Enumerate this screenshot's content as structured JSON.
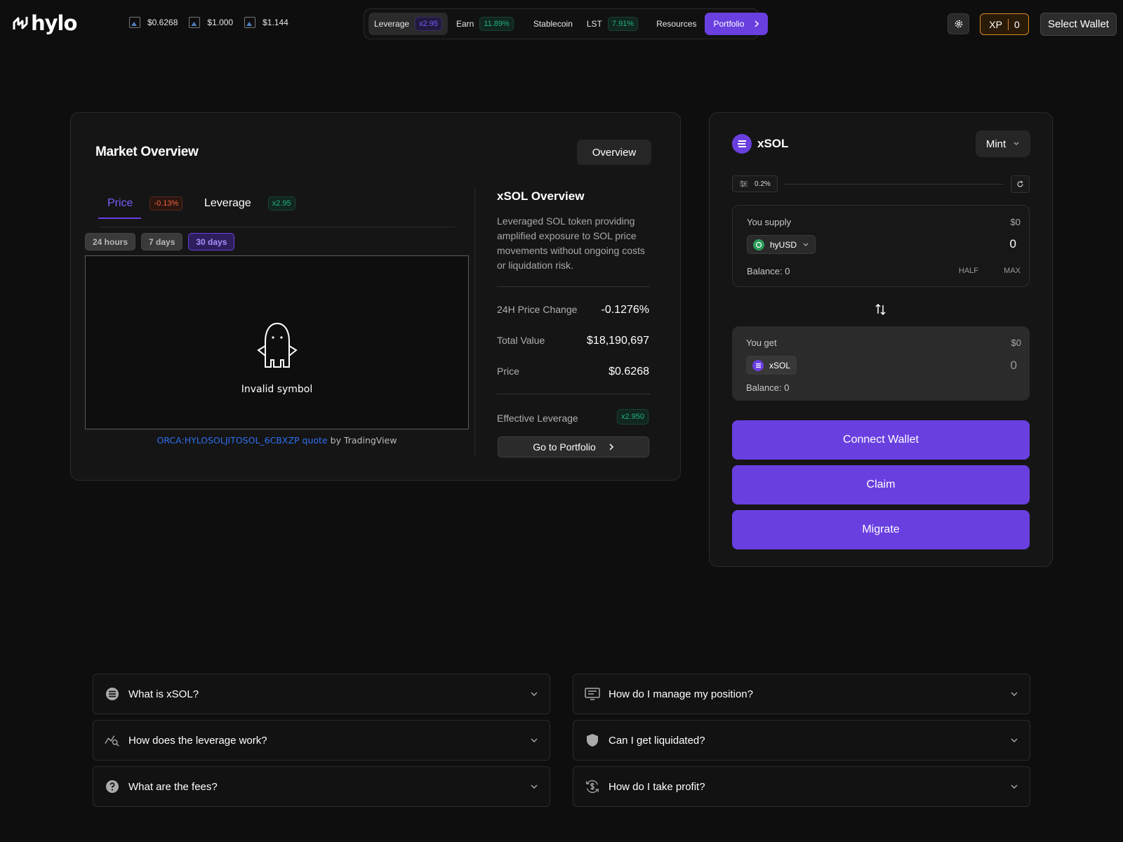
{
  "header": {
    "logo_text": "hylo",
    "prices": [
      {
        "value": "$0.6268"
      },
      {
        "value": "$1.000"
      },
      {
        "value": "$1.144"
      }
    ],
    "nav": [
      {
        "label": "Leverage",
        "badge": "x2.95",
        "badge_color": "purple",
        "active": true
      },
      {
        "label": "Earn",
        "badge": "11.89%",
        "badge_color": "green"
      },
      {
        "label": "Stablecoin",
        "badge": ""
      },
      {
        "label": "LST",
        "badge": "7.91%",
        "badge_color": "green"
      },
      {
        "label": "Resources",
        "badge": ""
      }
    ],
    "portfolio_label": "Portfolio",
    "xp_label": "XP",
    "xp_value": "0",
    "select_wallet_label": "Select Wallet"
  },
  "market": {
    "title": "Market Overview",
    "overview_button": "Overview",
    "tabs": {
      "price_label": "Price",
      "price_badge": "-0.13%",
      "leverage_label": "Leverage",
      "leverage_badge": "x2.95"
    },
    "ranges": [
      "24 hours",
      "7 days",
      "30 days"
    ],
    "active_range": "30 days",
    "chart_message": "Invalid symbol",
    "attribution_link": "ORCA:HYLOSOLJITOSOL_6CBXZP quote",
    "attribution_suffix": " by TradingView"
  },
  "overview": {
    "title": "xSOL Overview",
    "description": "Leveraged SOL token providing amplified exposure to SOL price movements without ongoing costs or liquidation risk.",
    "stats": [
      {
        "label": "24H Price Change",
        "value": "-0.1276%"
      },
      {
        "label": "Total Value",
        "value": "$18,190,697"
      },
      {
        "label": "Price",
        "value": "$0.6268"
      }
    ],
    "effective_leverage_label": "Effective Leverage",
    "effective_leverage_value": "x2.950",
    "go_to_portfolio": "Go to Portfolio"
  },
  "swap": {
    "token": "xSOL",
    "mode": "Mint",
    "slippage": "0.2%",
    "supply": {
      "label": "You supply",
      "usd": "$0",
      "token": "hyUSD",
      "amount": "0",
      "balance": "Balance: 0",
      "half": "HALF",
      "max": "MAX"
    },
    "get": {
      "label": "You get",
      "usd": "$0",
      "token": "xSOL",
      "amount": "0",
      "balance": "Balance: 0"
    },
    "buttons": {
      "connect": "Connect Wallet",
      "claim": "Claim",
      "migrate": "Migrate"
    }
  },
  "faq": {
    "left": [
      {
        "question": "What is xSOL?",
        "icon": "xsol-coin-icon"
      },
      {
        "question": "How does the leverage work?",
        "icon": "chart-search-icon"
      },
      {
        "question": "What are the fees?",
        "icon": "question-circle-icon"
      }
    ],
    "right": [
      {
        "question": "How do I manage my position?",
        "icon": "monitor-icon"
      },
      {
        "question": "Can I get liquidated?",
        "icon": "shield-icon"
      },
      {
        "question": "How do I take profit?",
        "icon": "dollar-refresh-icon"
      }
    ]
  },
  "colors": {
    "accent": "#6a3fe0",
    "background": "#0e0e0e",
    "card": "#151515",
    "positive": "#22b27a",
    "negative": "#f0643a",
    "xp": "#d68a28"
  }
}
